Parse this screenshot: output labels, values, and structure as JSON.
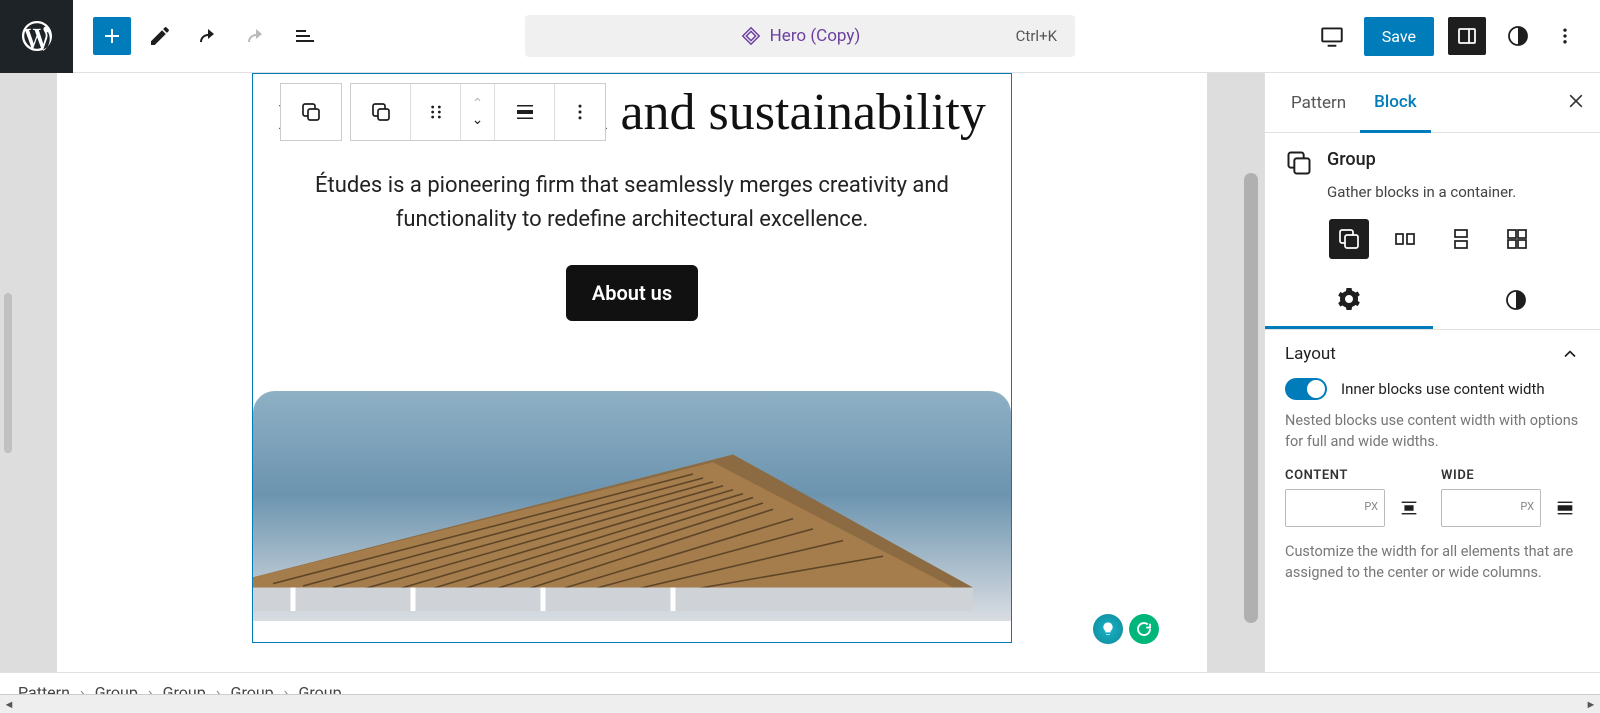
{
  "topbar": {
    "document_title": "Hero (Copy)",
    "keyboard_shortcut": "Ctrl+K",
    "save_label": "Save"
  },
  "block_toolbar": {
    "parent_block": "Group",
    "current_block": "Group"
  },
  "hero": {
    "heading_visible": "nt to innovation and sustainability",
    "heading_full": "A commitment to innovation and sustainability",
    "subheading": "Études is a pioneering firm that seamlessly merges creativity and functionality to redefine architectural excellence.",
    "button_label": "About us"
  },
  "sidebar": {
    "tabs": {
      "pattern": "Pattern",
      "block": "Block"
    },
    "block": {
      "name": "Group",
      "description": "Gather blocks in a container."
    },
    "panel": {
      "layout_title": "Layout",
      "content_width_toggle_label": "Inner blocks use content width",
      "content_width_help": "Nested blocks use content width with options for full and wide widths.",
      "content_label": "CONTENT",
      "wide_label": "WIDE",
      "unit": "PX",
      "customize_help": "Customize the width for all elements that are assigned to the center or wide columns."
    }
  },
  "breadcrumb": [
    "Pattern",
    "Group",
    "Group",
    "Group",
    "Group"
  ]
}
